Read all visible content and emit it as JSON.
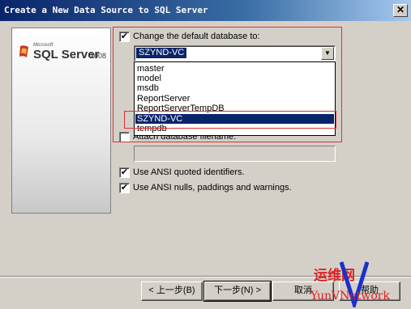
{
  "window": {
    "title": "Create a New Data Source to SQL Server",
    "close_glyph": "✕"
  },
  "logo": {
    "microsoft": "Microsoft",
    "product": "SQL Server",
    "version": "2008"
  },
  "options": {
    "change_default_db": {
      "label": "Change the default database to:",
      "checked": true
    },
    "default_db_value": "SZYND-VC",
    "database_list": [
      "master",
      "model",
      "msdb",
      "ReportServer",
      "ReportServerTempDB",
      "SZYND-VC",
      "tempdb"
    ],
    "selected_database": "SZYND-VC",
    "attach_db": {
      "label": "Attach database filename:",
      "checked": false,
      "value": ""
    },
    "ansi_quoted": {
      "label": "Use ANSI quoted identifiers.",
      "checked": true
    },
    "ansi_nulls": {
      "label": "Use ANSI nulls, paddings and warnings.",
      "checked": true
    }
  },
  "buttons": {
    "back": "< 上一步(B)",
    "next": "下一步(N) >",
    "cancel": "取消",
    "help": "帮助"
  },
  "watermark": {
    "chinese": "运维网",
    "english": "YunVNetwork",
    "letter": "V"
  },
  "colors": {
    "selection": "#0a246a",
    "highlight_box": "#e03030",
    "watermark": "#e02020"
  }
}
